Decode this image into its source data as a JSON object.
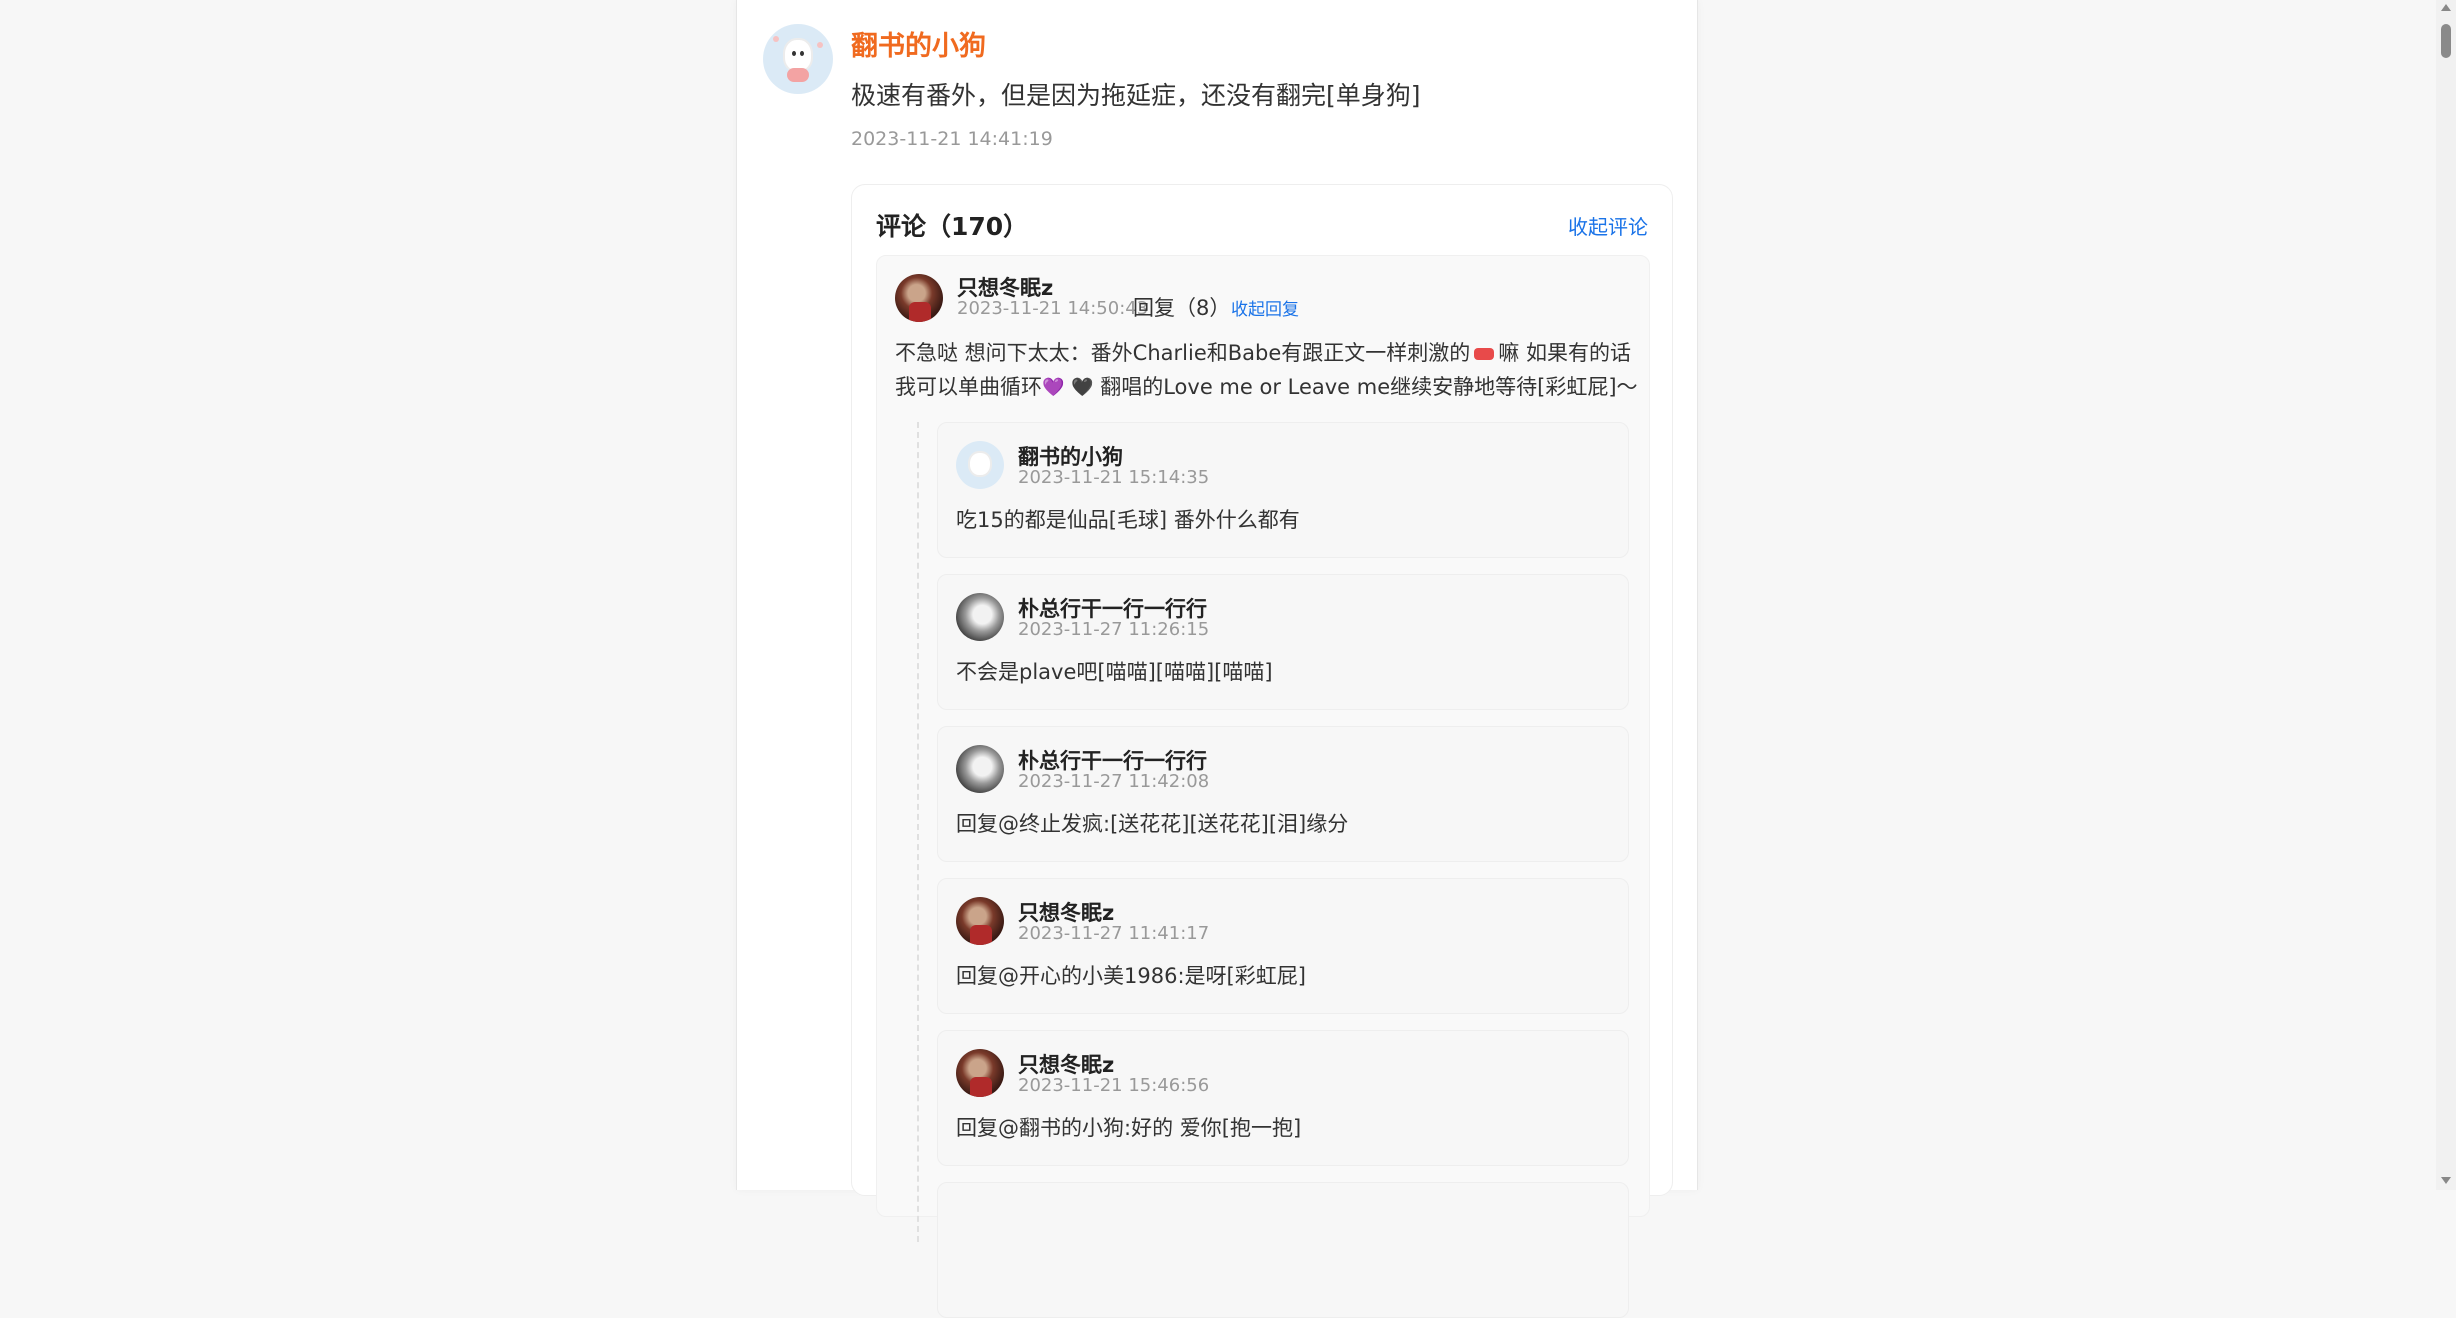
{
  "post": {
    "author": "翻书的小狗",
    "text": "极速有番外，但是因为拖延症，还没有翻完[单身狗]",
    "time": "2023-11-21 14:41:19",
    "author_color": "#f06a1f"
  },
  "comments": {
    "title": "评论（170）",
    "collapse_label": "收起评论",
    "top": {
      "author": "只想冬眠z",
      "time": "2023-11-21 14:50:43",
      "reply_count": "回复（8）",
      "collapse_replies": "收起回复",
      "text_line1_a": "不急哒 想问下太太：番外Charlie和Babe有跟正文一样刺激的",
      "text_line1_b": "嘛 如果有的话",
      "text_line2_a": "我可以单曲循环",
      "text_line2_b": "翻唱的Love me or Leave me继续安静地等待[彩虹屁]～",
      "emoji_purple": "💜",
      "emoji_black": "🖤"
    },
    "replies": [
      {
        "author": "翻书的小狗",
        "time": "2023-11-21 15:14:35",
        "text": "吃15的都是仙品[毛球] 番外什么都有",
        "avatar": "blue"
      },
      {
        "author": "朴总行干一行一行行",
        "time": "2023-11-27 11:26:15",
        "text": "不会是plave吧[喵喵][喵喵][喵喵]",
        "avatar": "gray"
      },
      {
        "author": "朴总行干一行一行行",
        "time": "2023-11-27 11:42:08",
        "text": "回复@终止发疯:[送花花][送花花][泪]缘分",
        "avatar": "gray"
      },
      {
        "author": "只想冬眠z",
        "time": "2023-11-27 11:41:17",
        "text": "回复@开心的小美1986:是呀[彩虹屁]",
        "avatar": "dark"
      },
      {
        "author": "只想冬眠z",
        "time": "2023-11-21 15:46:56",
        "text": "回复@翻书的小狗:好的 爱你[抱一抱]",
        "avatar": "dark"
      }
    ]
  },
  "colors": {
    "link": "#1a73e8",
    "background": "#f7f7f7"
  }
}
